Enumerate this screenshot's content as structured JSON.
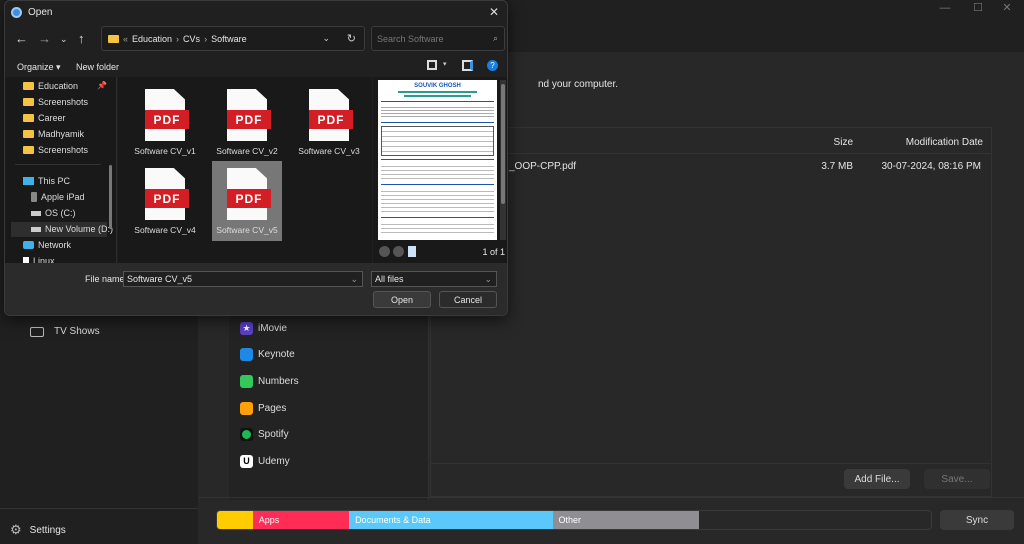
{
  "background_app": {
    "window_controls": [
      "—",
      "☐",
      "✕"
    ],
    "tagline": "nd your computer.",
    "sidebar": {
      "items": [
        {
          "label": "TV Shows",
          "icon": "tv-icon"
        }
      ],
      "settings_label": "Settings"
    },
    "apps_list": [
      {
        "label": "iMovie",
        "color": "#5b3fc4"
      },
      {
        "label": "Keynote",
        "color": "#1e88e5"
      },
      {
        "label": "Numbers",
        "color": "#34c759"
      },
      {
        "label": "Pages",
        "color": "#ff9f0a"
      },
      {
        "label": "Spotify",
        "color": "#1db954"
      },
      {
        "label": "Udemy",
        "color": "#ffffff"
      }
    ],
    "files_table": {
      "columns": {
        "size": "Size",
        "date": "Modification Date"
      },
      "rows": [
        {
          "name": "_OOP-CPP.pdf",
          "size": "3.7 MB",
          "date": "30-07-2024, 08:16 PM"
        }
      ]
    },
    "add_file_label": "Add File...",
    "save_label": "Save...",
    "sync_label": "Sync",
    "storage": [
      {
        "label": "",
        "color": "#ffcc00",
        "fraction": 0.05
      },
      {
        "label": "Apps",
        "color": "#ff2d55",
        "fraction": 0.135
      },
      {
        "label": "Documents & Data",
        "color": "#5ac8fa",
        "fraction": 0.285
      },
      {
        "label": "Other",
        "color": "#8e8e93",
        "fraction": 0.205
      }
    ]
  },
  "dialog": {
    "title": "Open",
    "breadcrumb": [
      "Education",
      "CVs",
      "Software"
    ],
    "search_placeholder": "Search Software",
    "organize_label": "Organize ▾",
    "new_folder_label": "New folder",
    "nav": {
      "quick_access": [
        "Education",
        "Screenshots",
        "Career",
        "Madhyamik",
        "Screenshots"
      ],
      "this_pc": "This PC",
      "devices": [
        "Apple iPad",
        "OS (C:)",
        "New Volume (D:)"
      ],
      "network": "Network",
      "linux": "Linux"
    },
    "files": [
      {
        "name": "Software CV_v1",
        "type": "PDF",
        "selected": false
      },
      {
        "name": "Software CV_v2",
        "type": "PDF",
        "selected": false
      },
      {
        "name": "Software CV_v3",
        "type": "PDF",
        "selected": false
      },
      {
        "name": "Software CV_v4",
        "type": "PDF",
        "selected": false
      },
      {
        "name": "Software CV_v5",
        "type": "PDF",
        "selected": true
      }
    ],
    "preview": {
      "doc_name": "SOUVIK GHOSH",
      "page_indicator": "1 of 1"
    },
    "file_name_label": "File name:",
    "file_name_value": "Software CV_v5",
    "filter_value": "All files",
    "open_label": "Open",
    "cancel_label": "Cancel"
  }
}
